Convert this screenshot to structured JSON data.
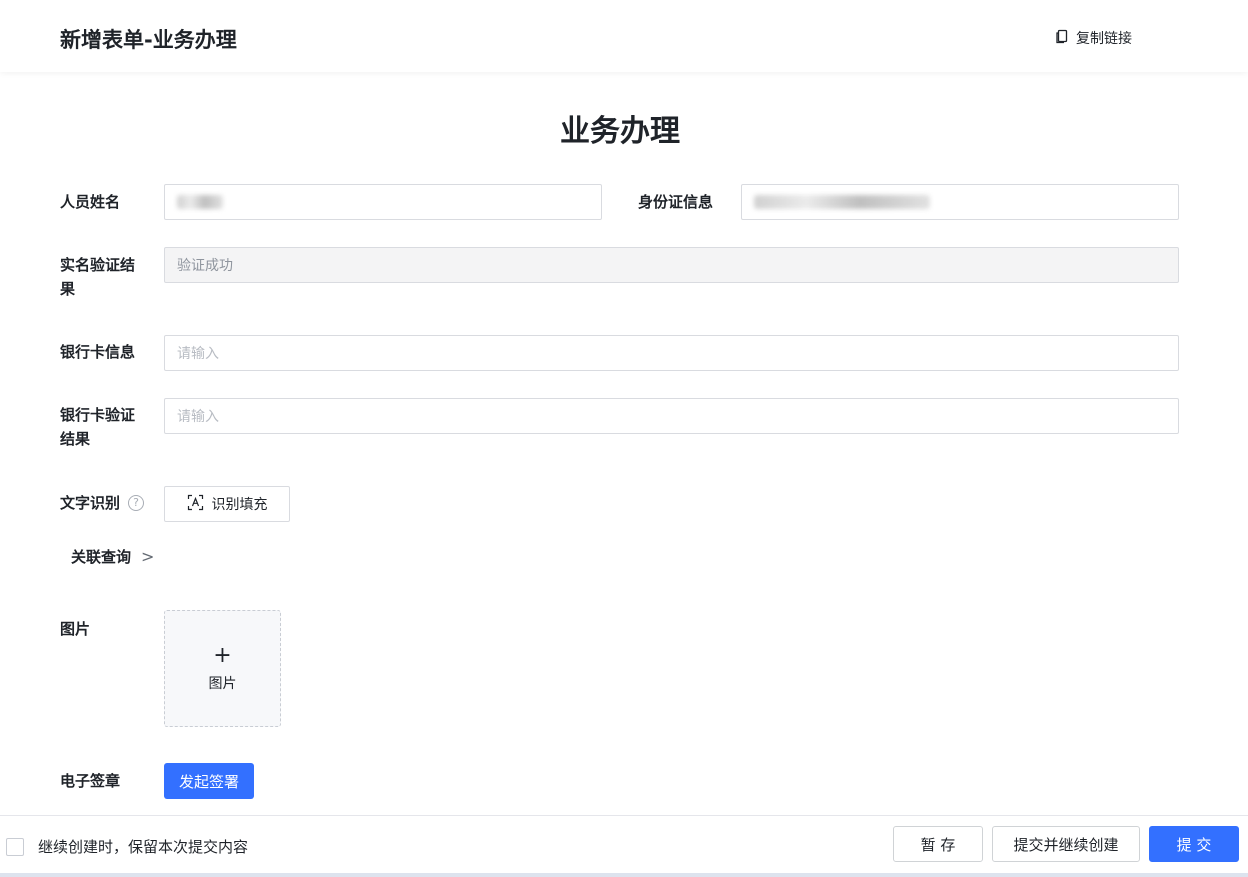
{
  "header": {
    "title": "新增表单-业务办理",
    "copy_link_label": "复制链接",
    "copy_icon": "copy-icon"
  },
  "form": {
    "title": "业务办理",
    "fields": {
      "name": {
        "label": "人员姓名"
      },
      "id_info": {
        "label": "身份证信息"
      },
      "verify_result": {
        "label_line1": "实名验证结",
        "label_line2": "果",
        "value": "验证成功"
      },
      "bank_card": {
        "label": "银行卡信息",
        "placeholder": "请输入"
      },
      "bank_verify": {
        "label_line1": "银行卡验证",
        "label_line2": "结果",
        "placeholder": "请输入"
      },
      "ocr": {
        "label": "文字识别",
        "help_icon": "?",
        "button_label": "识别填充"
      },
      "associated_query": {
        "label": "关联查询",
        "chevron": ">"
      },
      "image": {
        "label": "图片",
        "upload_plus": "+",
        "upload_label": "图片"
      },
      "esign": {
        "label": "电子签章",
        "button_label": "发起签署"
      }
    }
  },
  "footer": {
    "keep_content_label": "继续创建时，保留本次提交内容",
    "save_draft_label": "暂 存",
    "submit_continue_label": "提交并继续创建",
    "submit_label": "提 交"
  },
  "colors": {
    "primary": "#3370ff",
    "border": "#d9dbe0",
    "disabled_bg": "#f4f4f5"
  }
}
